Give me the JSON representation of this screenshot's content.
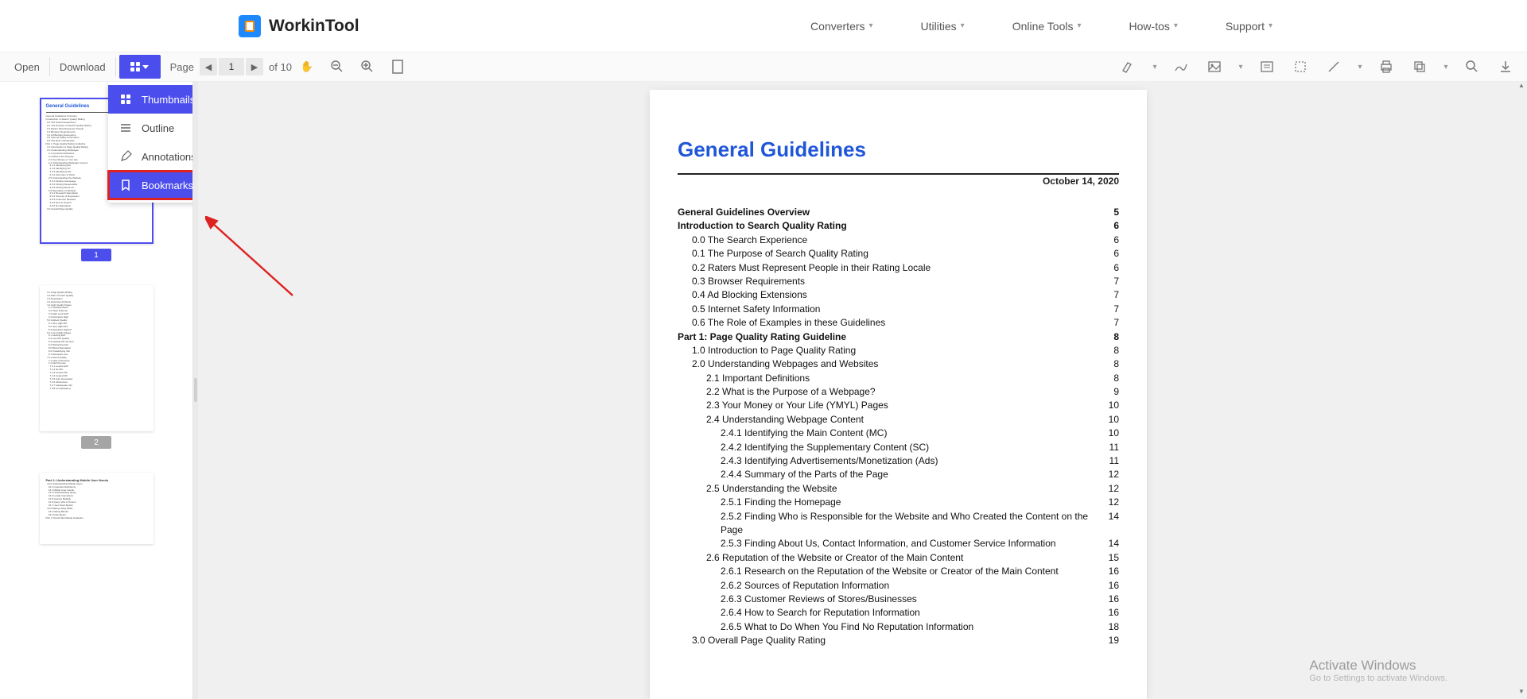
{
  "brand": "WorkinTool",
  "nav": {
    "converters": "Converters",
    "utilities": "Utilities",
    "online_tools": "Online Tools",
    "how_tos": "How-tos",
    "support": "Support"
  },
  "toolbar": {
    "open": "Open",
    "download": "Download",
    "page_label": "Page",
    "page_current": "1",
    "page_of": "of 10"
  },
  "dropdown": {
    "thumbnails": "Thumbnails",
    "outline": "Outline",
    "annotations": "Annotations",
    "bookmarks": "Bookmarks"
  },
  "thumbs": {
    "p1_title": "General Guidelines",
    "p1": "1",
    "p2": "2"
  },
  "doc": {
    "title": "General Guidelines",
    "date": "October 14, 2020",
    "toc": [
      {
        "t": "General Guidelines Overview",
        "p": "5",
        "i": 0,
        "b": true
      },
      {
        "t": "Introduction to Search Quality Rating",
        "p": "6",
        "i": 0,
        "b": true
      },
      {
        "t": "0.0 The Search Experience",
        "p": "6",
        "i": 1
      },
      {
        "t": "0.1 The Purpose of Search Quality Rating",
        "p": "6",
        "i": 1
      },
      {
        "t": "0.2 Raters Must Represent People in their Rating Locale",
        "p": "6",
        "i": 1
      },
      {
        "t": "0.3 Browser Requirements",
        "p": "7",
        "i": 1
      },
      {
        "t": "0.4 Ad Blocking Extensions",
        "p": "7",
        "i": 1
      },
      {
        "t": "0.5 Internet Safety Information",
        "p": "7",
        "i": 1
      },
      {
        "t": "0.6 The Role of Examples in these Guidelines",
        "p": "7",
        "i": 1
      },
      {
        "t": "Part 1: Page Quality Rating Guideline",
        "p": "8",
        "i": 0,
        "b": true
      },
      {
        "t": "1.0 Introduction to Page Quality Rating",
        "p": "8",
        "i": 1
      },
      {
        "t": "2.0 Understanding Webpages and Websites",
        "p": "8",
        "i": 1
      },
      {
        "t": "2.1 Important Definitions",
        "p": "8",
        "i": 2
      },
      {
        "t": "2.2 What is the Purpose of a Webpage?",
        "p": "9",
        "i": 2
      },
      {
        "t": "2.3 Your Money or Your Life (YMYL) Pages",
        "p": "10",
        "i": 2
      },
      {
        "t": "2.4 Understanding Webpage Content",
        "p": "10",
        "i": 2
      },
      {
        "t": "2.4.1 Identifying the Main Content (MC)",
        "p": "10",
        "i": 3
      },
      {
        "t": "2.4.2 Identifying the Supplementary Content (SC)",
        "p": "11",
        "i": 3
      },
      {
        "t": "2.4.3 Identifying Advertisements/Monetization (Ads)",
        "p": "11",
        "i": 3
      },
      {
        "t": "2.4.4 Summary of the Parts of the Page",
        "p": "12",
        "i": 3
      },
      {
        "t": "2.5 Understanding the Website",
        "p": "12",
        "i": 2
      },
      {
        "t": "2.5.1 Finding the Homepage",
        "p": "12",
        "i": 3
      },
      {
        "t": "2.5.2 Finding Who is Responsible for the Website and Who Created the Content on the Page",
        "p": "14",
        "i": 3
      },
      {
        "t": "2.5.3 Finding About Us, Contact Information, and Customer Service Information",
        "p": "14",
        "i": 3
      },
      {
        "t": "2.6 Reputation of the Website or Creator of the Main Content",
        "p": "15",
        "i": 2
      },
      {
        "t": "2.6.1 Research on the Reputation of the Website or Creator of the Main Content",
        "p": "16",
        "i": 3
      },
      {
        "t": "2.6.2 Sources of Reputation Information",
        "p": "16",
        "i": 3
      },
      {
        "t": "2.6.3 Customer Reviews of Stores/Businesses",
        "p": "16",
        "i": 3
      },
      {
        "t": "2.6.4 How to Search for Reputation Information",
        "p": "16",
        "i": 3
      },
      {
        "t": "2.6.5 What to Do When You Find No Reputation Information",
        "p": "18",
        "i": 3
      },
      {
        "t": "3.0 Overall Page Quality Rating",
        "p": "19",
        "i": 1
      }
    ]
  },
  "watermark": {
    "title": "Activate Windows",
    "sub": "Go to Settings to activate Windows."
  }
}
